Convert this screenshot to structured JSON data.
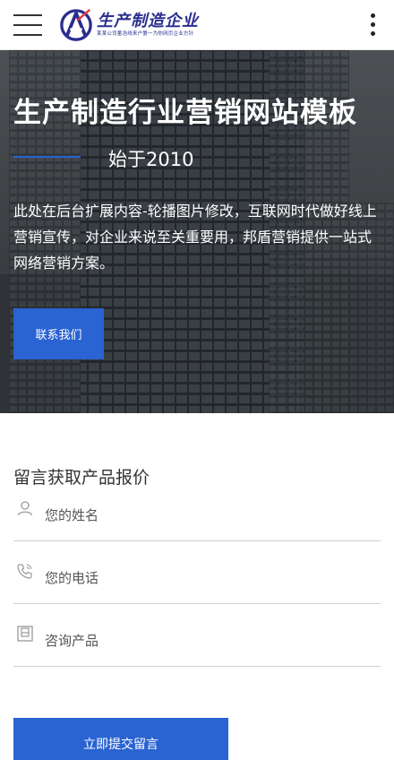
{
  "header": {
    "logo_title": "生产制造企业",
    "logo_slogan": "某某公司董浩线来户第一为你网页企业方针",
    "menu_icon": "hamburger-menu-icon",
    "more_icon": "vertical-dots-icon"
  },
  "banner": {
    "title": "生产制造行业营销网站模板",
    "since": "始于2010",
    "description": "此处在后台扩展内容-轮播图片修改，互联网时代做好线上营销宣传，对企业来说至关重要用，邦盾营销提供一站式网络营销方案。",
    "contact_button": "联系我们"
  },
  "form": {
    "title": "留言获取产品报价",
    "fields": [
      {
        "label": "您的姓名",
        "icon": "user-icon"
      },
      {
        "label": "您的电话",
        "icon": "phone-icon"
      },
      {
        "label": "咨询产品",
        "icon": "product-box-icon"
      }
    ],
    "submit_button": "立即提交留言"
  },
  "colors": {
    "accent": "#2a63d2",
    "logo": "#2a2e8f"
  }
}
